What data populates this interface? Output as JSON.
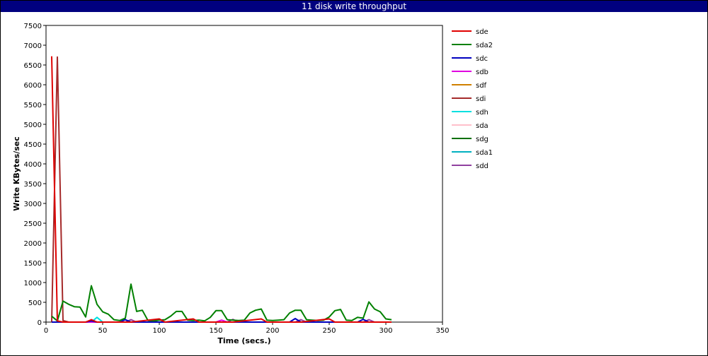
{
  "chart_data": {
    "type": "line",
    "title": "11 disk write throughput",
    "xlabel": "Time (secs.)",
    "ylabel": "Write KBytes/sec",
    "xlim": [
      0,
      350
    ],
    "ylim": [
      0,
      7500
    ],
    "xticks": [
      0,
      50,
      100,
      150,
      200,
      250,
      300,
      350
    ],
    "yticks": [
      0,
      500,
      1000,
      1500,
      2000,
      2500,
      3000,
      3500,
      4000,
      4500,
      5000,
      5500,
      6000,
      6500,
      7000,
      7500
    ],
    "grid": true,
    "legend_position": "right",
    "series": [
      {
        "name": "sde",
        "color": "#e00000",
        "points": [
          [
            5,
            6720
          ],
          [
            10,
            30
          ],
          [
            15,
            0
          ],
          [
            30,
            0
          ],
          [
            35,
            0
          ],
          [
            40,
            60
          ],
          [
            45,
            0
          ],
          [
            70,
            0
          ],
          [
            75,
            0
          ],
          [
            100,
            80
          ],
          [
            105,
            0
          ],
          [
            130,
            80
          ],
          [
            135,
            0
          ],
          [
            160,
            0
          ],
          [
            165,
            0
          ],
          [
            190,
            80
          ],
          [
            195,
            0
          ],
          [
            220,
            0
          ],
          [
            225,
            0
          ],
          [
            250,
            80
          ],
          [
            255,
            0
          ],
          [
            280,
            0
          ],
          [
            285,
            0
          ],
          [
            305,
            0
          ]
        ]
      },
      {
        "name": "sda2",
        "color": "#008000",
        "points": [
          [
            5,
            150
          ],
          [
            10,
            30
          ],
          [
            15,
            530
          ],
          [
            20,
            450
          ],
          [
            25,
            390
          ],
          [
            30,
            380
          ],
          [
            35,
            130
          ],
          [
            40,
            920
          ],
          [
            45,
            450
          ],
          [
            50,
            260
          ],
          [
            55,
            200
          ],
          [
            60,
            60
          ],
          [
            65,
            40
          ],
          [
            70,
            100
          ],
          [
            75,
            960
          ],
          [
            80,
            270
          ],
          [
            85,
            300
          ],
          [
            90,
            40
          ],
          [
            95,
            30
          ],
          [
            100,
            50
          ],
          [
            105,
            60
          ],
          [
            110,
            150
          ],
          [
            115,
            270
          ],
          [
            120,
            270
          ],
          [
            125,
            50
          ],
          [
            130,
            40
          ],
          [
            135,
            50
          ],
          [
            140,
            30
          ],
          [
            145,
            120
          ],
          [
            150,
            290
          ],
          [
            155,
            290
          ],
          [
            160,
            60
          ],
          [
            165,
            50
          ],
          [
            170,
            40
          ],
          [
            175,
            50
          ],
          [
            180,
            230
          ],
          [
            185,
            300
          ],
          [
            190,
            330
          ],
          [
            195,
            50
          ],
          [
            200,
            40
          ],
          [
            205,
            50
          ],
          [
            210,
            60
          ],
          [
            215,
            230
          ],
          [
            220,
            300
          ],
          [
            225,
            300
          ],
          [
            230,
            60
          ],
          [
            235,
            50
          ],
          [
            240,
            40
          ],
          [
            245,
            50
          ],
          [
            250,
            130
          ],
          [
            255,
            290
          ],
          [
            260,
            320
          ],
          [
            265,
            50
          ],
          [
            270,
            40
          ],
          [
            275,
            120
          ],
          [
            280,
            100
          ],
          [
            285,
            510
          ],
          [
            290,
            330
          ],
          [
            295,
            260
          ],
          [
            300,
            80
          ],
          [
            305,
            60
          ]
        ]
      },
      {
        "name": "sdc",
        "color": "#0000c0",
        "points": [
          [
            5,
            0
          ],
          [
            35,
            0
          ],
          [
            40,
            30
          ],
          [
            45,
            0
          ],
          [
            65,
            0
          ],
          [
            70,
            60
          ],
          [
            75,
            0
          ],
          [
            215,
            0
          ],
          [
            220,
            90
          ],
          [
            225,
            0
          ],
          [
            275,
            0
          ],
          [
            280,
            70
          ],
          [
            285,
            0
          ],
          [
            305,
            0
          ]
        ]
      },
      {
        "name": "sdb",
        "color": "#e000e0",
        "points": [
          [
            5,
            0
          ],
          [
            150,
            0
          ],
          [
            155,
            50
          ],
          [
            160,
            0
          ],
          [
            305,
            0
          ]
        ]
      },
      {
        "name": "sdf",
        "color": "#d08000",
        "points": [
          [
            5,
            0
          ],
          [
            95,
            0
          ],
          [
            100,
            60
          ],
          [
            105,
            0
          ],
          [
            305,
            0
          ]
        ]
      },
      {
        "name": "sdi",
        "color": "#a52a2a",
        "points": [
          [
            5,
            0
          ],
          [
            10,
            6700
          ],
          [
            15,
            40
          ],
          [
            20,
            0
          ],
          [
            305,
            0
          ]
        ]
      },
      {
        "name": "sdh",
        "color": "#00e0e0",
        "points": [
          [
            5,
            0
          ],
          [
            40,
            0
          ],
          [
            45,
            120
          ],
          [
            50,
            0
          ],
          [
            305,
            0
          ]
        ]
      },
      {
        "name": "sda",
        "color": "#ffc0cb",
        "points": [
          [
            5,
            0
          ],
          [
            305,
            0
          ]
        ]
      },
      {
        "name": "sdg",
        "color": "#007000",
        "points": [
          [
            5,
            0
          ],
          [
            305,
            0
          ]
        ]
      },
      {
        "name": "sda1",
        "color": "#00b0c0",
        "points": [
          [
            5,
            0
          ],
          [
            305,
            0
          ]
        ]
      },
      {
        "name": "sdd",
        "color": "#9040a0",
        "points": [
          [
            5,
            0
          ],
          [
            70,
            0
          ],
          [
            75,
            60
          ],
          [
            80,
            0
          ],
          [
            160,
            0
          ],
          [
            165,
            70
          ],
          [
            170,
            0
          ],
          [
            220,
            0
          ],
          [
            225,
            60
          ],
          [
            230,
            0
          ],
          [
            280,
            0
          ],
          [
            285,
            60
          ],
          [
            290,
            0
          ],
          [
            305,
            0
          ]
        ]
      }
    ]
  }
}
